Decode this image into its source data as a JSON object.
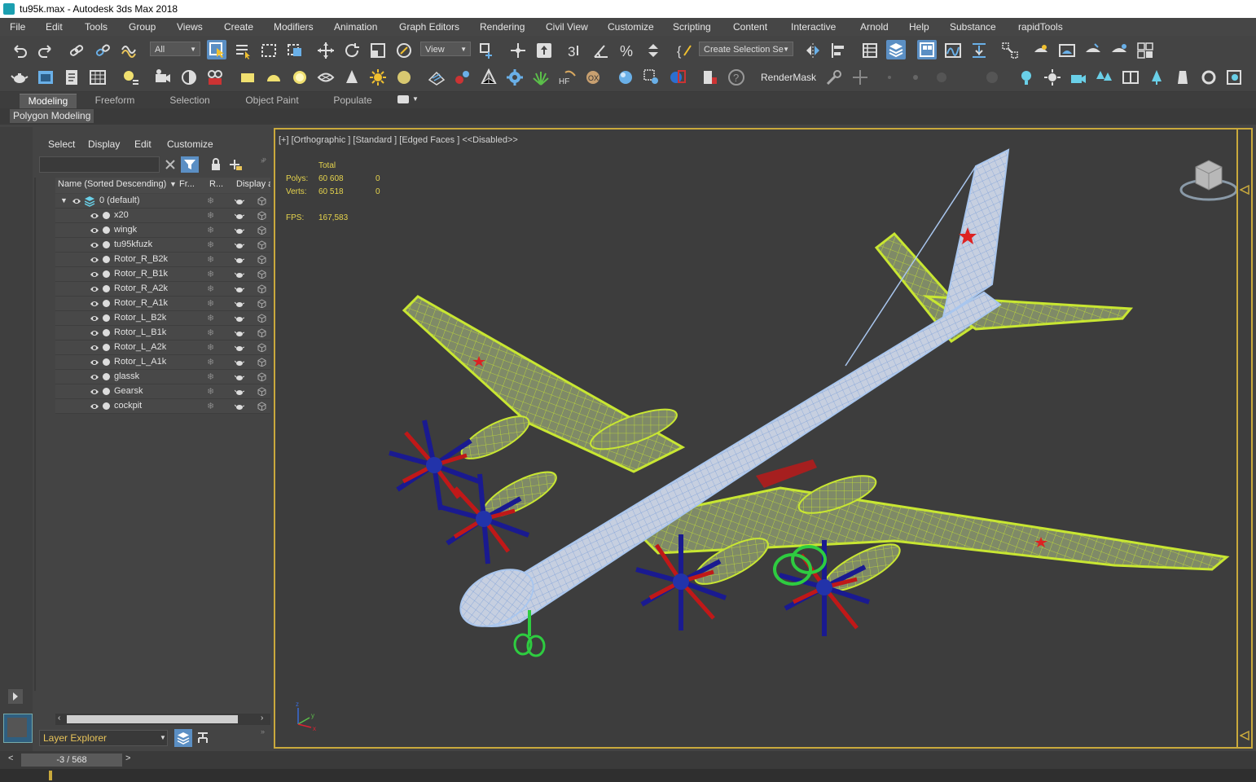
{
  "window": {
    "title": "tu95k.max - Autodesk 3ds Max 2018"
  },
  "menu": [
    "File",
    "Edit",
    "Tools",
    "Group",
    "Views",
    "Create",
    "Modifiers",
    "Animation",
    "Graph Editors",
    "Rendering",
    "Civil View",
    "Customize",
    "Scripting",
    "Content",
    "Interactive",
    "Arnold",
    "Help",
    "Substance",
    "rapidTools"
  ],
  "toolbar": {
    "selection_filter": "All",
    "ref_coord": "View",
    "named_selection": "Create Selection Se",
    "render_mask": "RenderMask"
  },
  "ribbon": {
    "tabs": [
      "Modeling",
      "Freeform",
      "Selection",
      "Object Paint",
      "Populate"
    ],
    "active_tab": "Modeling",
    "panel_label": "Polygon Modeling"
  },
  "explorer": {
    "menu": [
      "Select",
      "Display",
      "Edit",
      "Customize"
    ],
    "columns": [
      "Name (Sorted Descending)",
      "Fr...",
      "R...",
      "Display a"
    ],
    "layer": "0 (default)",
    "objects": [
      "x20",
      "wingk",
      "tu95kfuzk",
      "Rotor_R_B2k",
      "Rotor_R_B1k",
      "Rotor_R_A2k",
      "Rotor_R_A1k",
      "Rotor_L_B2k",
      "Rotor_L_B1k",
      "Rotor_L_A2k",
      "Rotor_L_A1k",
      "glassk",
      "Gearsk",
      "cockpit"
    ],
    "bottom_dropdown": "Layer Explorer"
  },
  "viewport": {
    "label": "[+] [Orthographic ] [Standard ] [Edged Faces ]  <<Disabled>>",
    "stats": {
      "total_label": "Total",
      "polys_label": "Polys:",
      "polys_value": "60 608",
      "polys_sel": "0",
      "verts_label": "Verts:",
      "verts_value": "60 518",
      "verts_sel": "0",
      "fps_label": "FPS:",
      "fps_value": "167,583"
    }
  },
  "timeline": {
    "frame": "-3 / 568"
  },
  "colors": {
    "accent": "#5b8fc4",
    "viewport_border": "#c9a93c",
    "stats_text": "#e6d44d",
    "wire_green": "#c8e632",
    "wire_blue": "#a9c6ee"
  }
}
